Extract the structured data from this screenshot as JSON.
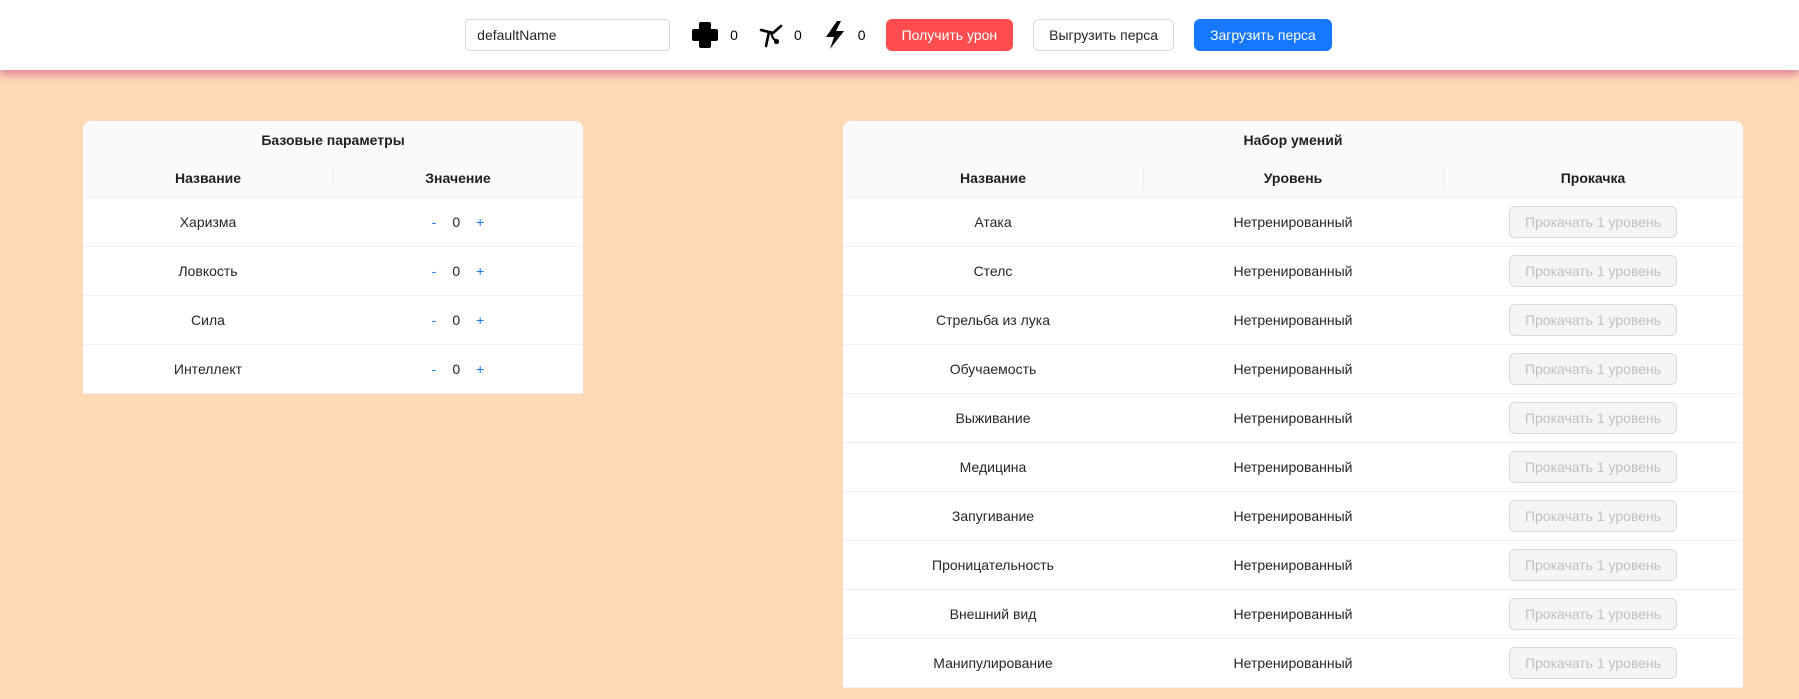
{
  "header": {
    "name_value": "defaultName",
    "stats": [
      {
        "icon": "health-cross-icon",
        "value": "0"
      },
      {
        "icon": "evasion-icon",
        "value": "0"
      },
      {
        "icon": "energy-bolt-icon",
        "value": "0"
      }
    ],
    "damage_button": "Получить урон",
    "export_button": "Выгрузить перса",
    "import_button": "Загрузить перса"
  },
  "base_params": {
    "title": "Базовые параметры",
    "columns": [
      "Название",
      "Значение"
    ],
    "minus": "-",
    "plus": "+",
    "rows": [
      {
        "name": "Харизма",
        "value": "0"
      },
      {
        "name": "Ловкость",
        "value": "0"
      },
      {
        "name": "Сила",
        "value": "0"
      },
      {
        "name": "Интеллект",
        "value": "0"
      }
    ]
  },
  "skills": {
    "title": "Набор умений",
    "columns": [
      "Название",
      "Уровень",
      "Прокачка"
    ],
    "rows": [
      {
        "name": "Атака",
        "level": "Нетренированный",
        "action": "Прокачать 1 уровень"
      },
      {
        "name": "Стелс",
        "level": "Нетренированный",
        "action": "Прокачать 1 уровень"
      },
      {
        "name": "Стрельба из лука",
        "level": "Нетренированный",
        "action": "Прокачать 1 уровень"
      },
      {
        "name": "Обучаемость",
        "level": "Нетренированный",
        "action": "Прокачать 1 уровень"
      },
      {
        "name": "Выживание",
        "level": "Нетренированный",
        "action": "Прокачать 1 уровень"
      },
      {
        "name": "Медицина",
        "level": "Нетренированный",
        "action": "Прокачать 1 уровень"
      },
      {
        "name": "Запугивание",
        "level": "Нетренированный",
        "action": "Прокачать 1 уровень"
      },
      {
        "name": "Проницательность",
        "level": "Нетренированный",
        "action": "Прокачать 1 уровень"
      },
      {
        "name": "Внешний вид",
        "level": "Нетренированный",
        "action": "Прокачать 1 уровень"
      },
      {
        "name": "Манипулирование",
        "level": "Нетренированный",
        "action": "Прокачать 1 уровень"
      }
    ]
  },
  "colors": {
    "background": "#fdd9b6",
    "header_shadow": "#db7093",
    "danger": "#ff4d4f",
    "primary": "#1677ff"
  }
}
